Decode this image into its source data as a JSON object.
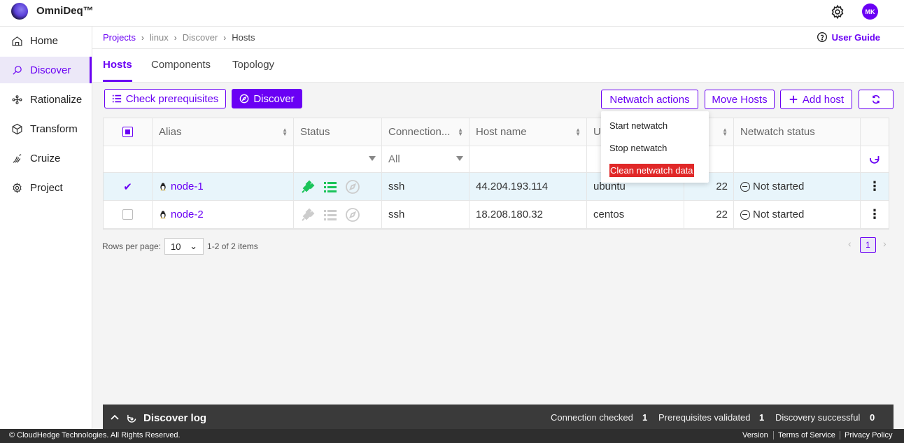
{
  "app": {
    "brand": "OmniDeq™",
    "avatar_initials": "MK",
    "accent": "#6a00f4"
  },
  "sidebar": {
    "items": [
      {
        "label": "Home",
        "icon": "home-icon"
      },
      {
        "label": "Discover",
        "icon": "discover-icon",
        "active": true
      },
      {
        "label": "Rationalize",
        "icon": "rationalize-icon"
      },
      {
        "label": "Transform",
        "icon": "cube-icon"
      },
      {
        "label": "Cruize",
        "icon": "cruize-icon"
      },
      {
        "label": "Project",
        "icon": "gear-icon"
      }
    ]
  },
  "breadcrumb": {
    "items": [
      "Projects",
      "linux",
      "Discover",
      "Hosts"
    ],
    "separator": "›"
  },
  "user_guide": "User Guide",
  "tabs": [
    {
      "label": "Hosts",
      "active": true
    },
    {
      "label": "Components"
    },
    {
      "label": "Topology"
    }
  ],
  "toolbar": {
    "check_prereq": "Check prerequisites",
    "discover": "Discover",
    "netwatch_actions": "Netwatch actions",
    "move_hosts": "Move Hosts",
    "add_host": "Add host"
  },
  "netwatch_menu": {
    "items": [
      "Start netwatch",
      "Stop netwatch",
      "Clean netwatch data"
    ]
  },
  "table": {
    "columns": [
      "Alias",
      "Status",
      "Connection...",
      "Host name",
      "Us",
      "",
      "Netwatch status"
    ],
    "filter_connection": "All",
    "rows": [
      {
        "alias": "node-1",
        "connection": "ssh",
        "hostname": "44.204.193.114",
        "user": "ubuntu",
        "port": "22",
        "netwatch": "Not started",
        "selected": true
      },
      {
        "alias": "node-2",
        "connection": "ssh",
        "hostname": "18.208.180.32",
        "user": "centos",
        "port": "22",
        "netwatch": "Not started",
        "selected": false
      }
    ]
  },
  "pager": {
    "rows_per_page_label": "Rows per page:",
    "rows_per_page": "10",
    "range": "1-2 of 2 items",
    "page": "1"
  },
  "discover_log": {
    "title": "Discover log",
    "connection_checked_label": "Connection checked",
    "connection_checked": "1",
    "prereq_label": "Prerequisites validated",
    "prereq": "1",
    "discovery_label": "Discovery successful",
    "discovery": "0"
  },
  "footer": {
    "copyright": "© CloudHedge Technologies. All Rights Reserved.",
    "links": [
      "Version",
      "Terms of Service",
      "Privacy Policy"
    ]
  }
}
